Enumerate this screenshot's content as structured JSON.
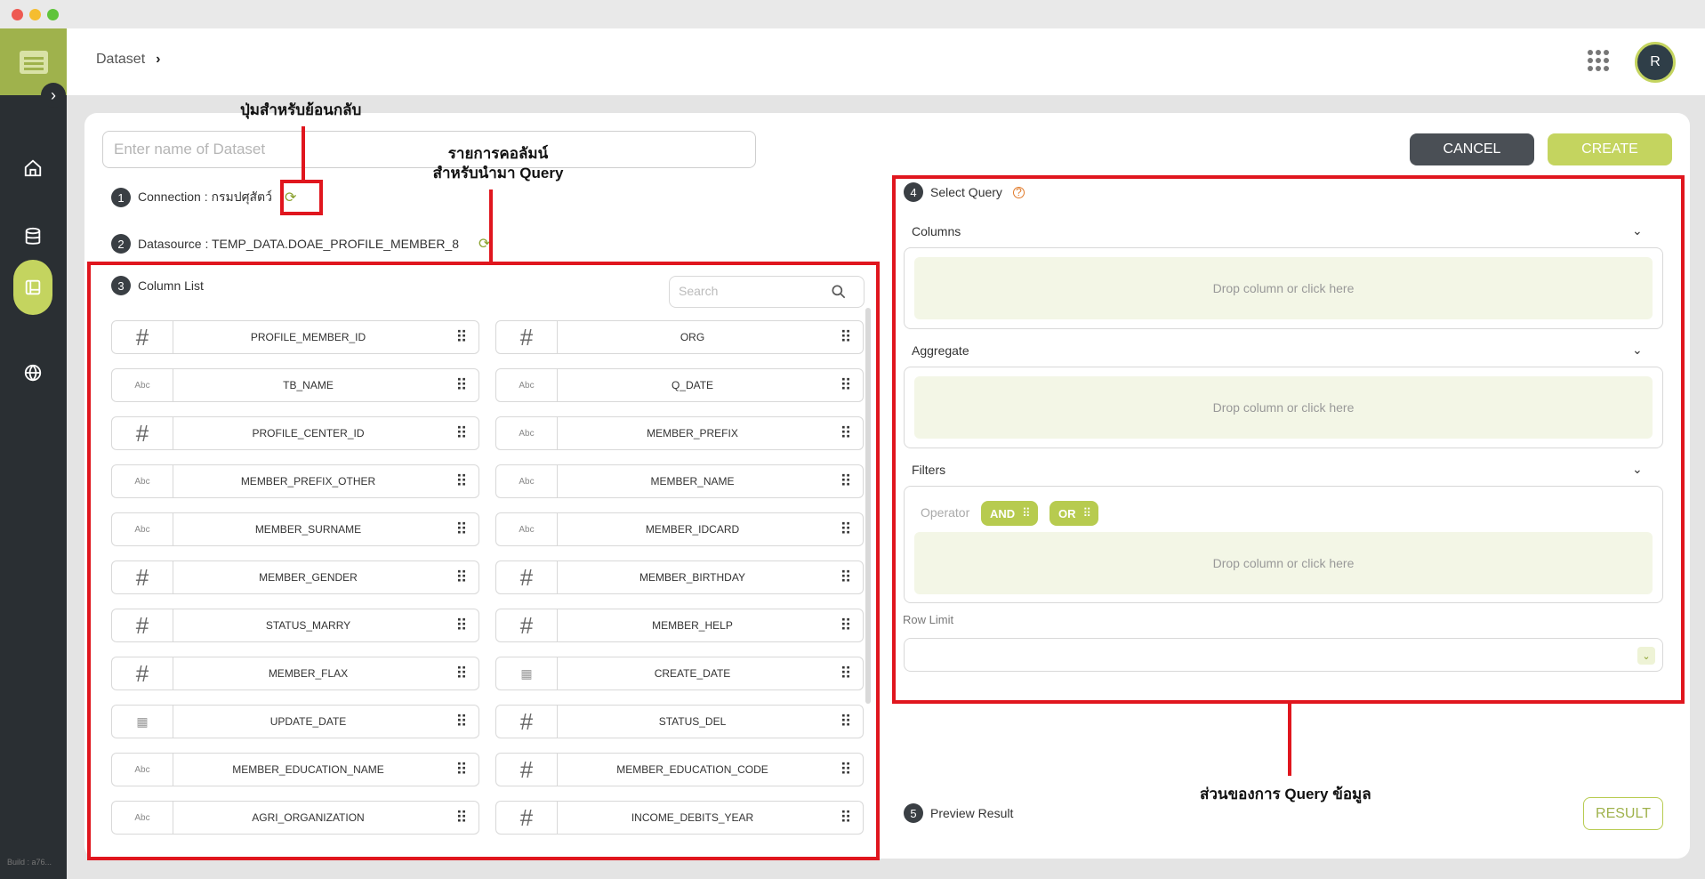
{
  "window": {
    "controls": [
      "close",
      "minimize",
      "maximize"
    ]
  },
  "sidebar": {
    "toggle_icon": "chevron-right-icon",
    "items": [
      {
        "icon": "home-icon",
        "active": false
      },
      {
        "icon": "database-icon",
        "active": false
      },
      {
        "icon": "dataset-icon",
        "active": true
      },
      {
        "icon": "globe-icon",
        "active": false
      }
    ],
    "build_label": "Build : a76..."
  },
  "header": {
    "breadcrumb": "Dataset",
    "breadcrumb_sep": "›",
    "avatar_initial": "R"
  },
  "form": {
    "name_placeholder": "Enter name of Dataset",
    "cancel_label": "CANCEL",
    "create_label": "CREATE"
  },
  "steps": {
    "connection": {
      "num": "1",
      "label": "Connection : กรมปศุสัตว์"
    },
    "datasource": {
      "num": "2",
      "label": "Datasource : TEMP_DATA.DOAE_PROFILE_MEMBER_8"
    },
    "column_list": {
      "num": "3",
      "label": "Column List"
    },
    "select_query": {
      "num": "4",
      "label": "Select Query"
    },
    "preview": {
      "num": "5",
      "label": "Preview Result"
    }
  },
  "search": {
    "placeholder": "Search"
  },
  "columns": [
    {
      "type": "#",
      "name": "PROFILE_MEMBER_ID"
    },
    {
      "type": "#",
      "name": "ORG"
    },
    {
      "type": "Abc",
      "name": "TB_NAME"
    },
    {
      "type": "Abc",
      "name": "Q_DATE"
    },
    {
      "type": "#",
      "name": "PROFILE_CENTER_ID"
    },
    {
      "type": "Abc",
      "name": "MEMBER_PREFIX"
    },
    {
      "type": "Abc",
      "name": "MEMBER_PREFIX_OTHER"
    },
    {
      "type": "Abc",
      "name": "MEMBER_NAME"
    },
    {
      "type": "Abc",
      "name": "MEMBER_SURNAME"
    },
    {
      "type": "Abc",
      "name": "MEMBER_IDCARD"
    },
    {
      "type": "#",
      "name": "MEMBER_GENDER"
    },
    {
      "type": "#",
      "name": "MEMBER_BIRTHDAY"
    },
    {
      "type": "#",
      "name": "STATUS_MARRY"
    },
    {
      "type": "#",
      "name": "MEMBER_HELP"
    },
    {
      "type": "#",
      "name": "MEMBER_FLAX"
    },
    {
      "type": "date",
      "name": "CREATE_DATE"
    },
    {
      "type": "date",
      "name": "UPDATE_DATE"
    },
    {
      "type": "#",
      "name": "STATUS_DEL"
    },
    {
      "type": "Abc",
      "name": "MEMBER_EDUCATION_NAME"
    },
    {
      "type": "#",
      "name": "MEMBER_EDUCATION_CODE"
    },
    {
      "type": "Abc",
      "name": "AGRI_ORGANIZATION"
    },
    {
      "type": "#",
      "name": "INCOME_DEBITS_YEAR"
    }
  ],
  "query": {
    "columns_label": "Columns",
    "aggregate_label": "Aggregate",
    "filters_label": "Filters",
    "drop_text": "Drop column or click here",
    "operator_label": "Operator",
    "and_label": "AND",
    "or_label": "OR",
    "row_limit_label": "Row Limit",
    "result_label": "RESULT"
  },
  "annotations": {
    "back_button": "ปุ่มสำหรับย้อนกลับ",
    "column_list_line1": "รายการคอลัมน์",
    "column_list_line2": "สำหรับนำมา Query",
    "query_part": "ส่วนของการ Query ข้อมูล"
  },
  "colors": {
    "accent": "#c4d45f",
    "sidebar": "#2a2f33",
    "annotation": "#e0161e"
  }
}
